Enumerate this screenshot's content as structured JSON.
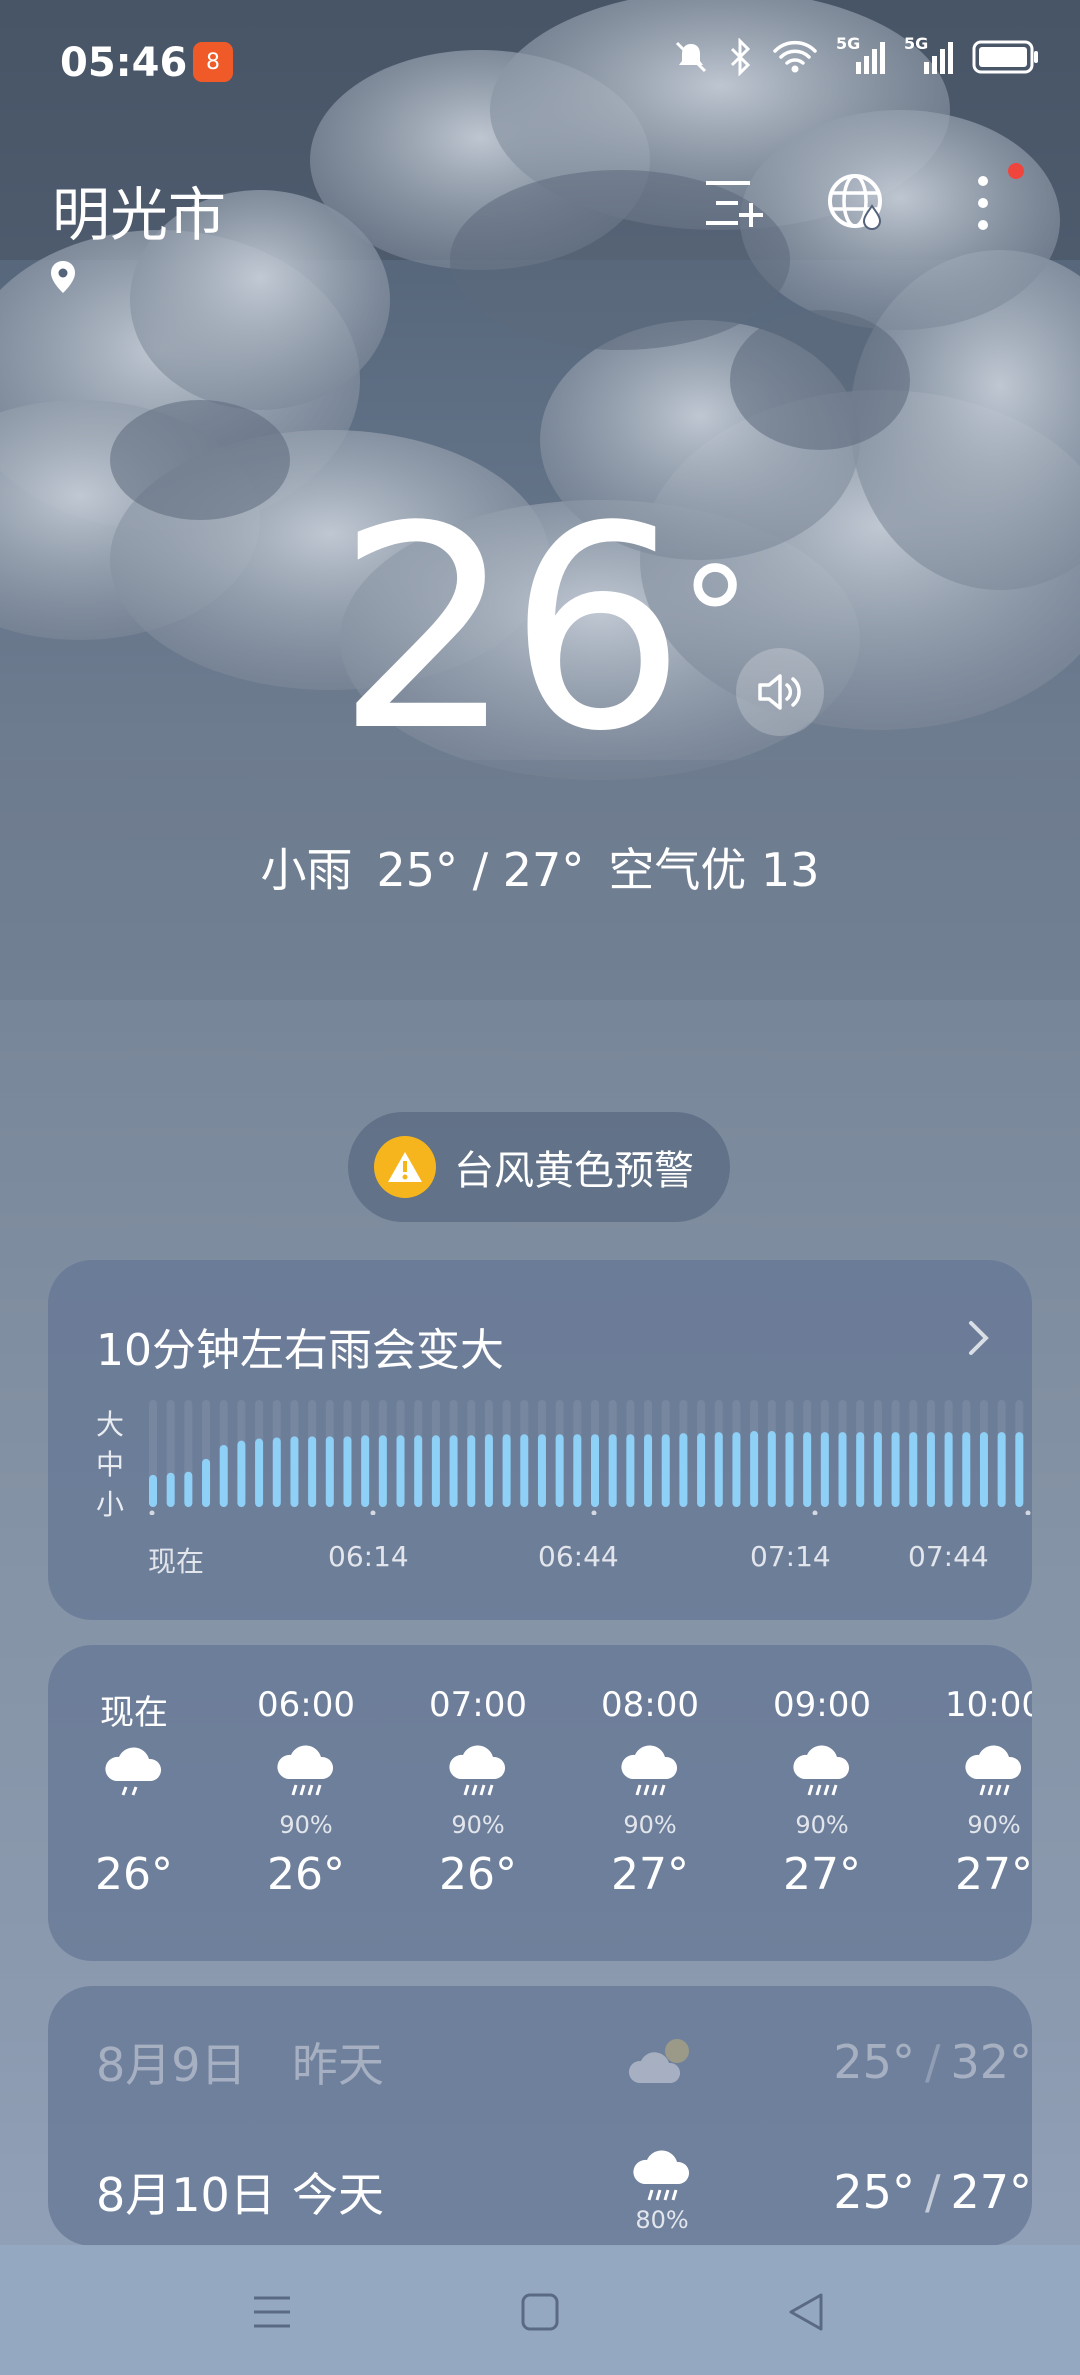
{
  "status_bar": {
    "time": "05:46",
    "app_badge": "8",
    "icons": [
      "mute-icon",
      "bluetooth-icon",
      "wifi-icon",
      "signal-5g-icon",
      "signal-5g-icon",
      "battery-icon"
    ],
    "network_label_1": "5G",
    "network_label_2": "5G"
  },
  "header": {
    "city": "明光市",
    "buttons": [
      "city-list-icon",
      "globe-icon",
      "more-icon"
    ]
  },
  "current": {
    "temp": "26",
    "deg": "°",
    "condition": "小雨",
    "range": "25° / 27°",
    "aqi": "空气优 13"
  },
  "alert": {
    "text": "台风黄色预警",
    "color": "#f6b51c"
  },
  "precipitation": {
    "title": "10分钟左右雨会变大",
    "intensity_labels": [
      "大",
      "中",
      "小"
    ],
    "axis": [
      "现在",
      "06:14",
      "06:44",
      "07:14",
      "07:44"
    ],
    "intensity_levels": [
      0.3,
      0.32,
      0.33,
      0.45,
      0.58,
      0.62,
      0.64,
      0.65,
      0.66,
      0.66,
      0.66,
      0.66,
      0.67,
      0.67,
      0.67,
      0.67,
      0.67,
      0.67,
      0.67,
      0.68,
      0.68,
      0.68,
      0.68,
      0.68,
      0.68,
      0.68,
      0.68,
      0.68,
      0.68,
      0.68,
      0.69,
      0.69,
      0.7,
      0.7,
      0.71,
      0.71,
      0.7,
      0.7,
      0.7,
      0.7,
      0.7,
      0.7,
      0.7,
      0.7,
      0.7,
      0.7,
      0.7,
      0.7,
      0.7,
      0.7
    ]
  },
  "hourly": [
    {
      "time": "现在",
      "icon": "light-rain-icon",
      "pop": "",
      "temp": "26°"
    },
    {
      "time": "06:00",
      "icon": "rain-icon",
      "pop": "90%",
      "temp": "26°"
    },
    {
      "time": "07:00",
      "icon": "rain-icon",
      "pop": "90%",
      "temp": "26°"
    },
    {
      "time": "08:00",
      "icon": "rain-icon",
      "pop": "90%",
      "temp": "27°"
    },
    {
      "time": "09:00",
      "icon": "rain-icon",
      "pop": "90%",
      "temp": "27°"
    },
    {
      "time": "10:00",
      "icon": "rain-icon",
      "pop": "90%",
      "temp": "27°"
    }
  ],
  "daily": [
    {
      "date": "8月9日",
      "label": "昨天",
      "icon": "partly-cloudy-icon",
      "pop": "",
      "low": "25°",
      "sep": "/",
      "high": "32°"
    },
    {
      "date": "8月10日",
      "label": "今天",
      "icon": "rain-icon",
      "pop": "80%",
      "low": "25°",
      "sep": "/",
      "high": "27°"
    }
  ],
  "navbar": [
    "menu-nav-icon",
    "home-nav-icon",
    "back-nav-icon"
  ]
}
